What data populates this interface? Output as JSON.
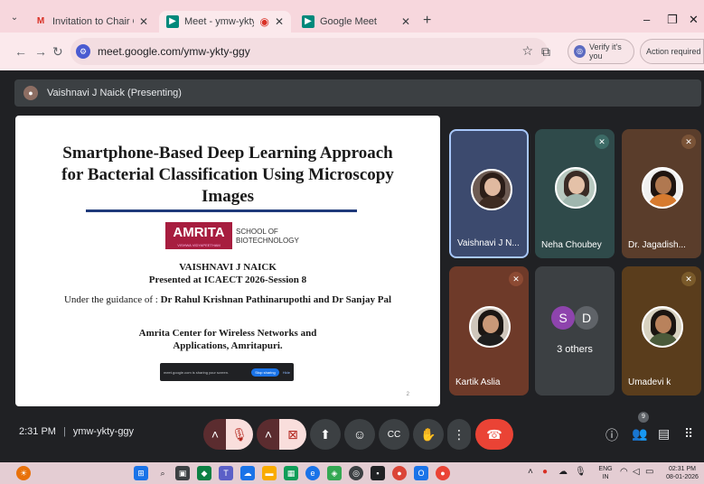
{
  "browser": {
    "tabs": [
      {
        "title": "Invitation to Chair ONLINE Tech",
        "active": false
      },
      {
        "title": "Meet - ymw-ykty-ggy",
        "active": true
      },
      {
        "title": "Google Meet",
        "active": false
      }
    ],
    "url": "meet.google.com/ymw-ykty-ggy",
    "verify_label": "Verify it's you",
    "action_label": "Action required"
  },
  "meet": {
    "presenter_label": "Vaishnavi J Naick (Presenting)",
    "meeting_code": "ymw-ykty-ggy",
    "time": "2:31 PM",
    "participant_count": "9"
  },
  "slide": {
    "title": "Smartphone-Based Deep Learning Approach for Bacterial Classification Using Microscopy Images",
    "logo": "AMRITA",
    "logo_sub": "VISHWA VIDYAPEETHAM",
    "school": "SCHOOL OF BIOTECHNOLOGY",
    "author": "VAISHNAVI J NAICK",
    "presented_at": "Presented at ICAECT 2026-Session 8",
    "guidance_prefix": "Under the guidance of : ",
    "guidance_names": "Dr Rahul Krishnan Pathinarupothi and Dr Sanjay Pal",
    "center_line1": "Amrita Center for Wireless Networks and",
    "center_line2": "Applications, Amritapuri.",
    "share_text": "meet.google.com is sharing your screen.",
    "stop_sharing": "Stop sharing",
    "hide": "Hide",
    "page": "2"
  },
  "participants": [
    {
      "name": "Vaishnavi J N...",
      "muted": false
    },
    {
      "name": "Neha Choubey",
      "muted": true
    },
    {
      "name": "Dr. Jagadish...",
      "muted": true
    },
    {
      "name": "Kartik Aslia",
      "muted": true
    },
    {
      "name": "3 others",
      "initials": [
        "S",
        "D"
      ]
    },
    {
      "name": "Umadevi k",
      "muted": true
    }
  ],
  "taskbar": {
    "lang_top": "ENG",
    "lang_bottom": "IN",
    "clock_time": "02:31 PM",
    "clock_date": "08-01-2026"
  },
  "colors": {
    "meet_bg": "#202124",
    "end_call": "#ea4335",
    "tab_strip": "#f7d7dd",
    "amrita": "#a71d3f"
  }
}
